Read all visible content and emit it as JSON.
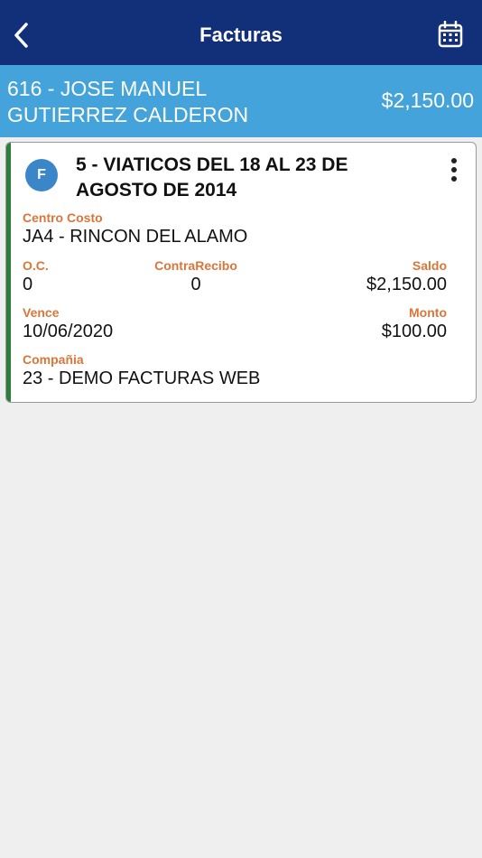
{
  "header": {
    "title": "Facturas",
    "back_icon": "chevron-left-icon",
    "calendar_icon": "calendar-icon"
  },
  "customer": {
    "name": "616 - JOSE MANUEL GUTIERREZ CALDERON",
    "amount": "$2,150.00"
  },
  "invoice": {
    "avatar_letter": "F",
    "title": "5 - VIATICOS DEL 18 AL 23 DE AGOSTO DE 2014",
    "centro_costo_label": "Centro Costo",
    "centro_costo_value": "JA4 - RINCON DEL ALAMO",
    "oc_label": "O.C.",
    "oc_value": "0",
    "contrarecibo_label": "ContraRecibo",
    "contrarecibo_value": "0",
    "saldo_label": "Saldo",
    "saldo_value": "$2,150.00",
    "vence_label": "Vence",
    "vence_value": "10/06/2020",
    "monto_label": "Monto",
    "monto_value": "$100.00",
    "compania_label": "Compañia",
    "compania_value": "23 - DEMO FACTURAS WEB"
  },
  "colors": {
    "header_bg": "#12307a",
    "customer_bar_bg": "#44a3db",
    "accent_green": "#2f7d3a",
    "label_orange": "#d9763a",
    "avatar_blue": "#3a86c8"
  }
}
